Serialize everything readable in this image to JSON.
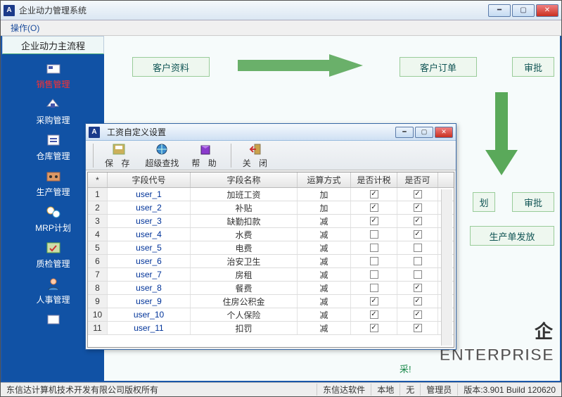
{
  "window": {
    "title": "企业动力管理系统"
  },
  "menu": {
    "operate": "操作(O)"
  },
  "sidebar": {
    "title": "企业动力主流程",
    "items": [
      {
        "label": "销售管理",
        "selected": true
      },
      {
        "label": "采购管理"
      },
      {
        "label": "仓库管理"
      },
      {
        "label": "生产管理"
      },
      {
        "label": "MRP计划"
      },
      {
        "label": "质检管理"
      },
      {
        "label": "人事管理"
      }
    ]
  },
  "bg": {
    "box_customer": "客户资料",
    "box_order": "客户订单",
    "box_approve": "审批",
    "box_plan": "划",
    "box_approve2": "审批",
    "box_release": "生产单发放",
    "cai": "采!",
    "ent": "ENTERPRISE",
    "qi": "企"
  },
  "dialog": {
    "title": "工资自定义设置",
    "toolbar": {
      "save": "保 存",
      "search": "超级查找",
      "help": "帮 助",
      "close": "关 闭"
    },
    "columns": {
      "star": "*",
      "code": "字段代号",
      "name": "字段名称",
      "calc": "运算方式",
      "tax": "是否计税",
      "enable": "是否可"
    },
    "rows": [
      {
        "n": 1,
        "code": "user_1",
        "name": "加班工资",
        "calc": "加",
        "tax": true,
        "enable": true
      },
      {
        "n": 2,
        "code": "user_2",
        "name": "补贴",
        "calc": "加",
        "tax": true,
        "enable": true
      },
      {
        "n": 3,
        "code": "user_3",
        "name": "缺勤扣款",
        "calc": "减",
        "tax": true,
        "enable": true
      },
      {
        "n": 4,
        "code": "user_4",
        "name": "水费",
        "calc": "减",
        "tax": false,
        "enable": true
      },
      {
        "n": 5,
        "code": "user_5",
        "name": "电费",
        "calc": "减",
        "tax": false,
        "enable": false
      },
      {
        "n": 6,
        "code": "user_6",
        "name": "治安卫生",
        "calc": "减",
        "tax": false,
        "enable": false
      },
      {
        "n": 7,
        "code": "user_7",
        "name": "房租",
        "calc": "减",
        "tax": false,
        "enable": false
      },
      {
        "n": 8,
        "code": "user_8",
        "name": "餐费",
        "calc": "减",
        "tax": false,
        "enable": true
      },
      {
        "n": 9,
        "code": "user_9",
        "name": "住房公积金",
        "calc": "减",
        "tax": true,
        "enable": true
      },
      {
        "n": 10,
        "code": "user_10",
        "name": "个人保险",
        "calc": "减",
        "tax": true,
        "enable": true
      },
      {
        "n": 11,
        "code": "user_11",
        "name": "扣罚",
        "calc": "减",
        "tax": true,
        "enable": true
      }
    ]
  },
  "status": {
    "copyright": "东信达计算机技术开发有限公司版权所有",
    "company": "东信达软件",
    "local": "本地",
    "none": "无",
    "role": "管理员",
    "version": "版本:3.901 Build 120620"
  }
}
